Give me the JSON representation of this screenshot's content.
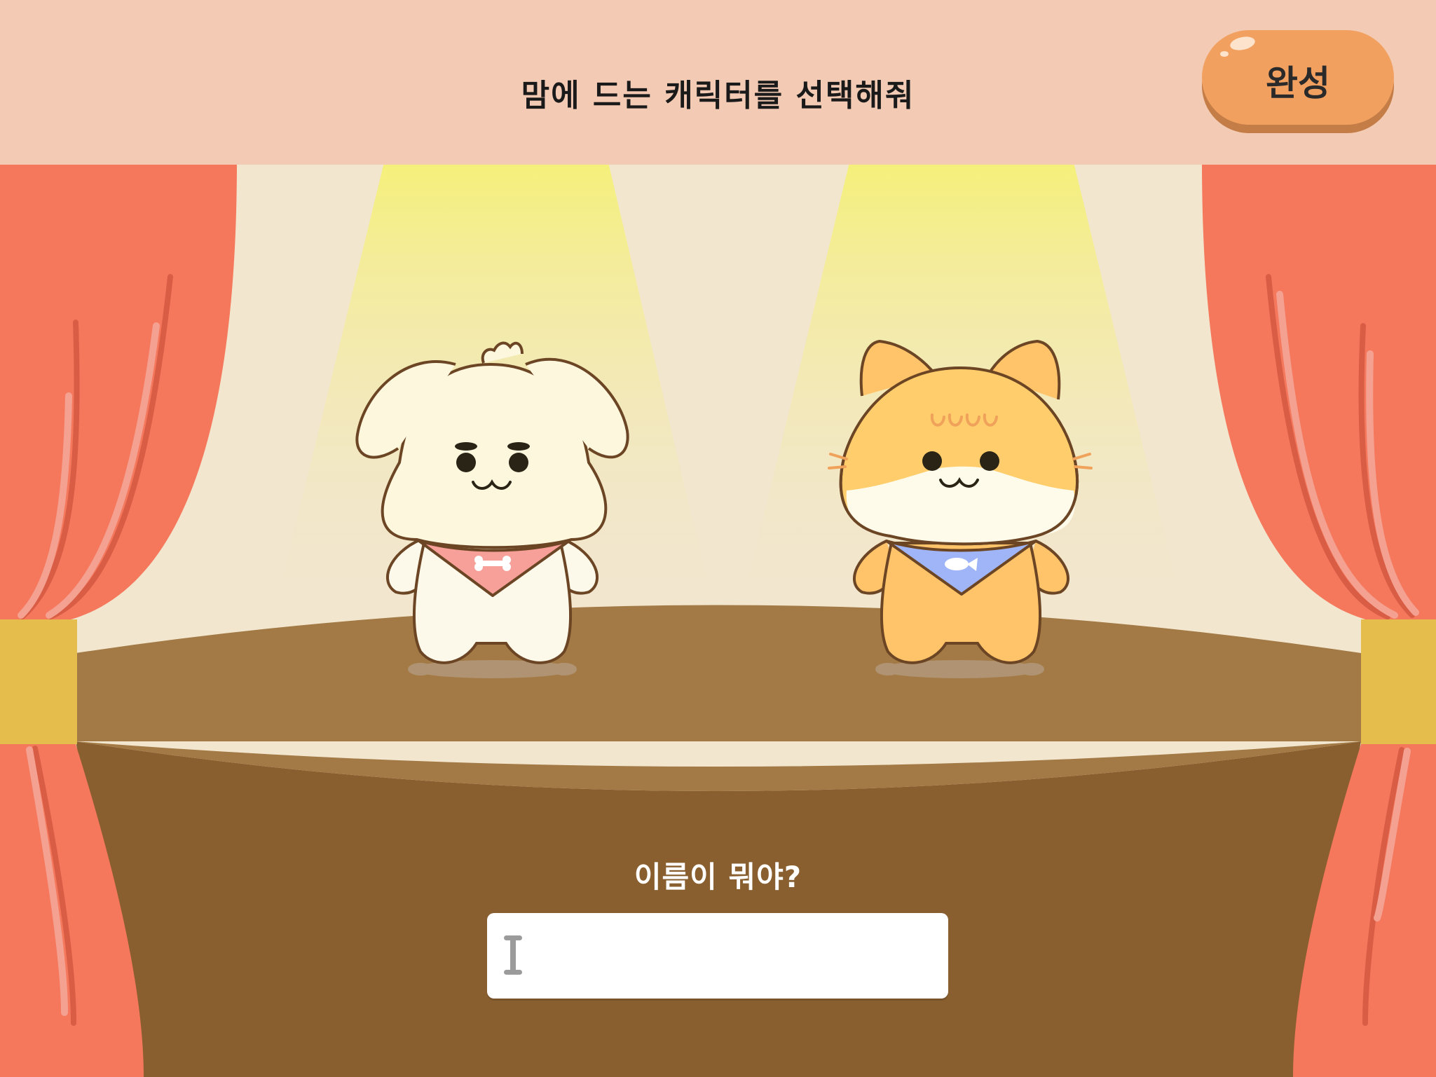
{
  "header": {
    "title": "맘에 드는 캐릭터를 선택해줘",
    "done_label": "완성"
  },
  "name_prompt": {
    "label": "이름이 뭐야?",
    "input_value": ""
  },
  "characters": [
    {
      "name": "puppy",
      "icon": "puppy-character",
      "bandana_icon": "bone-icon"
    },
    {
      "name": "cat",
      "icon": "cat-character",
      "bandana_icon": "fish-icon"
    }
  ],
  "colors": {
    "header_bg": "#f3cab3",
    "button": "#f2a060",
    "curtain": "#f5785c",
    "stage_top": "#a37a45",
    "stage_front": "#8a5f30",
    "spotlight": "#f5f07a"
  }
}
